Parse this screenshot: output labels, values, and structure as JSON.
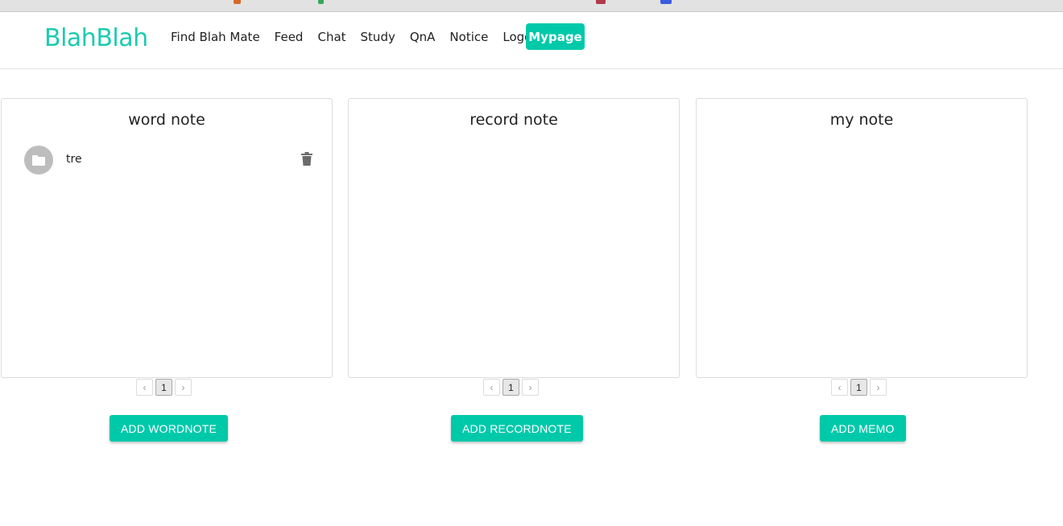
{
  "app": {
    "logo": "BlahBlah",
    "nav": [
      "Find Blah Mate",
      "Feed",
      "Chat",
      "Study",
      "QnA",
      "Notice",
      "Logout"
    ],
    "nav_active": "Mypage",
    "accent_color": "#00c9aa"
  },
  "panels": [
    {
      "title": "word note",
      "items": [
        {
          "label": "tre",
          "icon": "folder-icon",
          "action_icon": "trash-icon"
        }
      ],
      "pager": {
        "prev": "‹",
        "current": "1",
        "next": "›"
      },
      "button": "ADD WORDNOTE"
    },
    {
      "title": "record note",
      "items": [],
      "pager": {
        "prev": "‹",
        "current": "1",
        "next": "›"
      },
      "button": "ADD RECORDNOTE"
    },
    {
      "title": "my note",
      "items": [],
      "pager": {
        "prev": "‹",
        "current": "1",
        "next": "›"
      },
      "button": "ADD MEMO"
    }
  ]
}
